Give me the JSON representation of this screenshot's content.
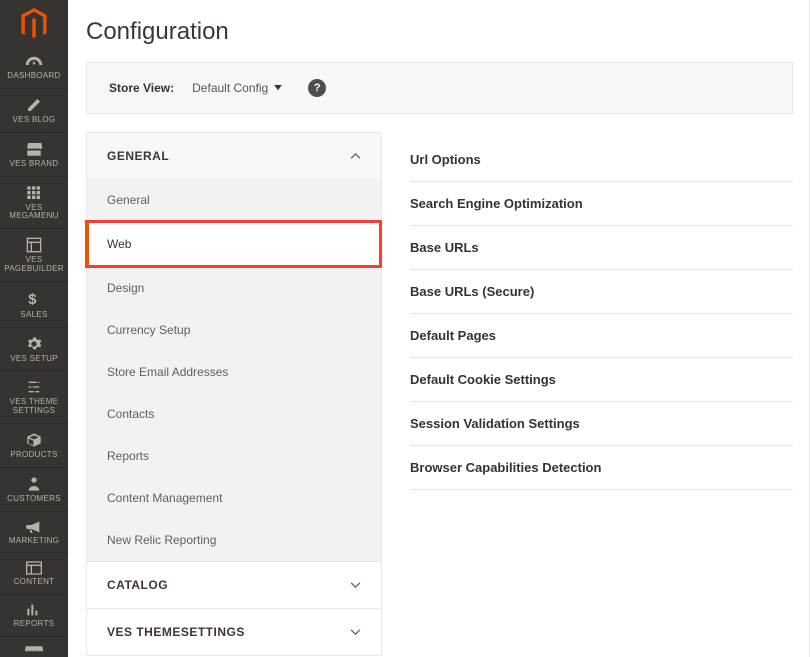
{
  "page": {
    "title": "Configuration"
  },
  "store_view": {
    "label": "Store View:",
    "value": "Default Config"
  },
  "sidebar": {
    "items": [
      {
        "label": "DASHBOARD"
      },
      {
        "label": "VES BLOG"
      },
      {
        "label": "VES BRAND"
      },
      {
        "label": "VES MEGAMENU"
      },
      {
        "label": "VES PAGEBUILDER"
      },
      {
        "label": "SALES"
      },
      {
        "label": "VES SETUP"
      },
      {
        "label": "VES THEME SETTINGS"
      },
      {
        "label": "PRODUCTS"
      },
      {
        "label": "CUSTOMERS"
      },
      {
        "label": "MARKETING"
      },
      {
        "label": "CONTENT"
      },
      {
        "label": "REPORTS"
      }
    ]
  },
  "config_nav": {
    "sections": [
      {
        "title": "GENERAL",
        "expanded": true
      },
      {
        "title": "CATALOG",
        "expanded": false
      },
      {
        "title": "VES THEMESETTINGS",
        "expanded": false
      }
    ],
    "general_items": [
      {
        "label": "General"
      },
      {
        "label": "Web",
        "active": true
      },
      {
        "label": "Design"
      },
      {
        "label": "Currency Setup"
      },
      {
        "label": "Store Email Addresses"
      },
      {
        "label": "Contacts"
      },
      {
        "label": "Reports"
      },
      {
        "label": "Content Management"
      },
      {
        "label": "New Relic Reporting"
      }
    ]
  },
  "detail": {
    "rows": [
      {
        "label": "Url Options"
      },
      {
        "label": "Search Engine Optimization"
      },
      {
        "label": "Base URLs"
      },
      {
        "label": "Base URLs (Secure)"
      },
      {
        "label": "Default Pages"
      },
      {
        "label": "Default Cookie Settings"
      },
      {
        "label": "Session Validation Settings"
      },
      {
        "label": "Browser Capabilities Detection"
      }
    ]
  }
}
